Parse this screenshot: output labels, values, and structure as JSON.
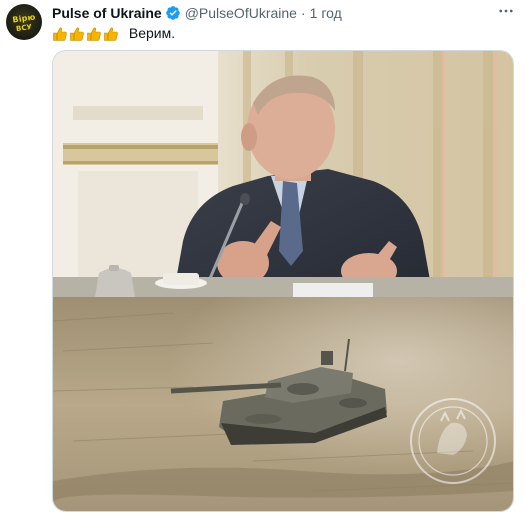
{
  "tweet": {
    "display_name": "Pulse of Ukraine",
    "handle": "@PulseOfUkraine",
    "separator": "·",
    "time": "1 год",
    "text": "Верим.",
    "emoji_count": 4,
    "more_label": "···"
  },
  "avatar": {
    "line1": "Вірю",
    "line2": "ВСУ"
  },
  "colors": {
    "name": "#0f1419",
    "secondary": "#536471",
    "verified": "#1d9bf0",
    "thumb": "#f4b400"
  },
  "icons": {
    "verified": "verified-badge-icon",
    "more": "more-horizontal-icon",
    "thumbs": "thumbs-up-icon"
  }
}
